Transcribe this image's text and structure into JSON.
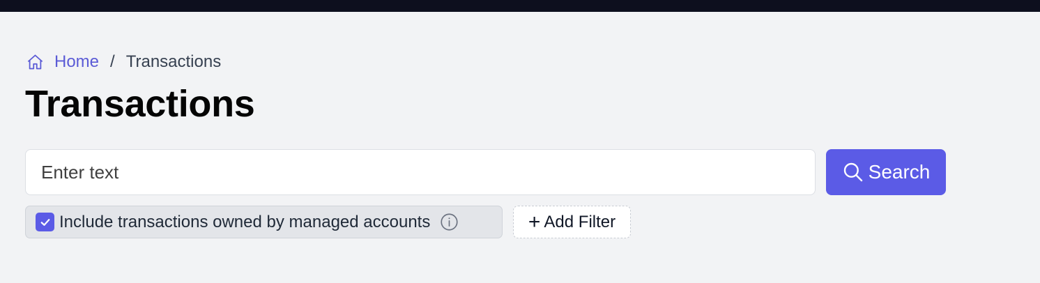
{
  "breadcrumb": {
    "home_icon": "home-icon",
    "home_label": "Home",
    "separator": "/",
    "current": "Transactions"
  },
  "page": {
    "title": "Transactions"
  },
  "search": {
    "placeholder": "Enter text",
    "value": "",
    "button_label": "Search",
    "button_icon": "search-icon"
  },
  "filters": {
    "managed_accounts": {
      "checked": true,
      "label": "Include transactions owned by managed accounts",
      "info_icon": "info-icon"
    },
    "add_filter_label": "Add Filter",
    "add_filter_icon": "plus-icon"
  },
  "colors": {
    "topbar": "#0d0f1e",
    "background": "#f2f3f5",
    "accent": "#5b5be6",
    "link": "#5b5bd6"
  }
}
